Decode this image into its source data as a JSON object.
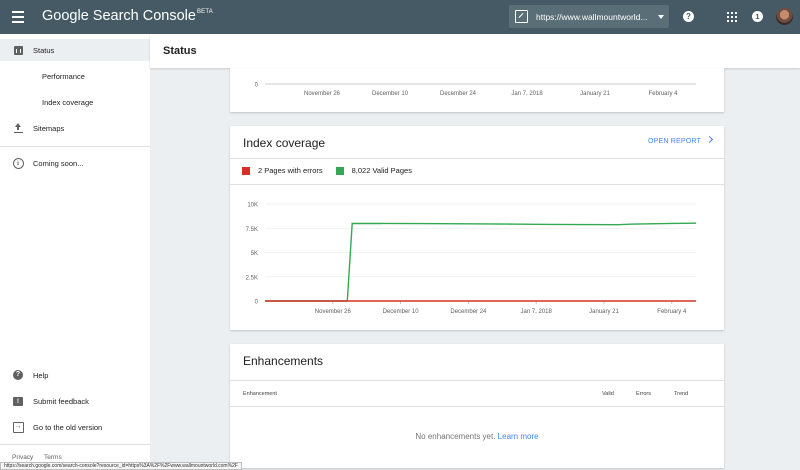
{
  "topbar": {
    "product_name": "Google Search Console",
    "product_badge": "BETA",
    "property_url": "https://www.wallmountworld...",
    "help_icon": "help-circle-icon",
    "apps_icon": "apps-grid-icon",
    "notification_count": "1"
  },
  "sidebar": {
    "items": [
      {
        "label": "Status",
        "icon": "bar-chart-icon"
      },
      {
        "label": "Performance"
      },
      {
        "label": "Index coverage"
      },
      {
        "label": "Sitemaps",
        "icon": "upload-icon"
      },
      {
        "label": "Coming soon...",
        "icon": "info-icon"
      }
    ],
    "bottom_items": [
      {
        "label": "Help",
        "icon": "help-icon"
      },
      {
        "label": "Submit feedback",
        "icon": "feedback-icon"
      },
      {
        "label": "Go to the old version",
        "icon": "exit-icon"
      }
    ],
    "footer": {
      "privacy": "Privacy",
      "terms": "Terms"
    }
  },
  "page": {
    "title": "Status"
  },
  "top_chart": {
    "y_tick": "0",
    "x_ticks": [
      "November 26",
      "December 10",
      "December 24",
      "Jan 7, 2018",
      "January 21",
      "February 4"
    ]
  },
  "index_coverage": {
    "title": "Index coverage",
    "open_report": "OPEN REPORT",
    "legend": [
      {
        "label": "2 Pages with errors",
        "color": "#d93025"
      },
      {
        "label": "8,022 Valid Pages",
        "color": "#34a853"
      }
    ],
    "chart_data": {
      "type": "line",
      "x_ticks": [
        "November 26",
        "December 10",
        "December 24",
        "Jan 7, 2018",
        "January 21",
        "February 4"
      ],
      "y_ticks": [
        "0",
        "2.5K",
        "5K",
        "7.5K",
        "10K"
      ],
      "ylim": [
        0,
        10000
      ],
      "x_range": [
        "2017-11-12",
        "2018-02-09"
      ],
      "series": [
        {
          "name": "2 Pages with errors",
          "color": "#d93025",
          "points": [
            [
              "2017-11-12",
              0
            ],
            [
              "2018-02-09",
              0
            ]
          ]
        },
        {
          "name": "8,022 Valid Pages",
          "color": "#34a853",
          "points": [
            [
              "2017-11-12",
              0
            ],
            [
              "2017-11-29",
              0
            ],
            [
              "2017-11-30",
              8000
            ],
            [
              "2017-12-14",
              7980
            ],
            [
              "2017-12-28",
              7950
            ],
            [
              "2018-01-10",
              7900
            ],
            [
              "2018-01-24",
              7870
            ],
            [
              "2018-01-27",
              7930
            ],
            [
              "2018-02-04",
              8000
            ],
            [
              "2018-02-09",
              8022
            ]
          ]
        }
      ]
    }
  },
  "enhancements": {
    "title": "Enhancements",
    "columns": [
      "Enhancement",
      "Valid",
      "Errors",
      "Trend"
    ],
    "empty_text": "No enhancements yet.",
    "learn_more": "Learn more"
  },
  "status_bar": {
    "url": "https://search.google.com/search-console?resource_id=https%3A%2F%2Fwww.wallmountworld.com%2F"
  }
}
